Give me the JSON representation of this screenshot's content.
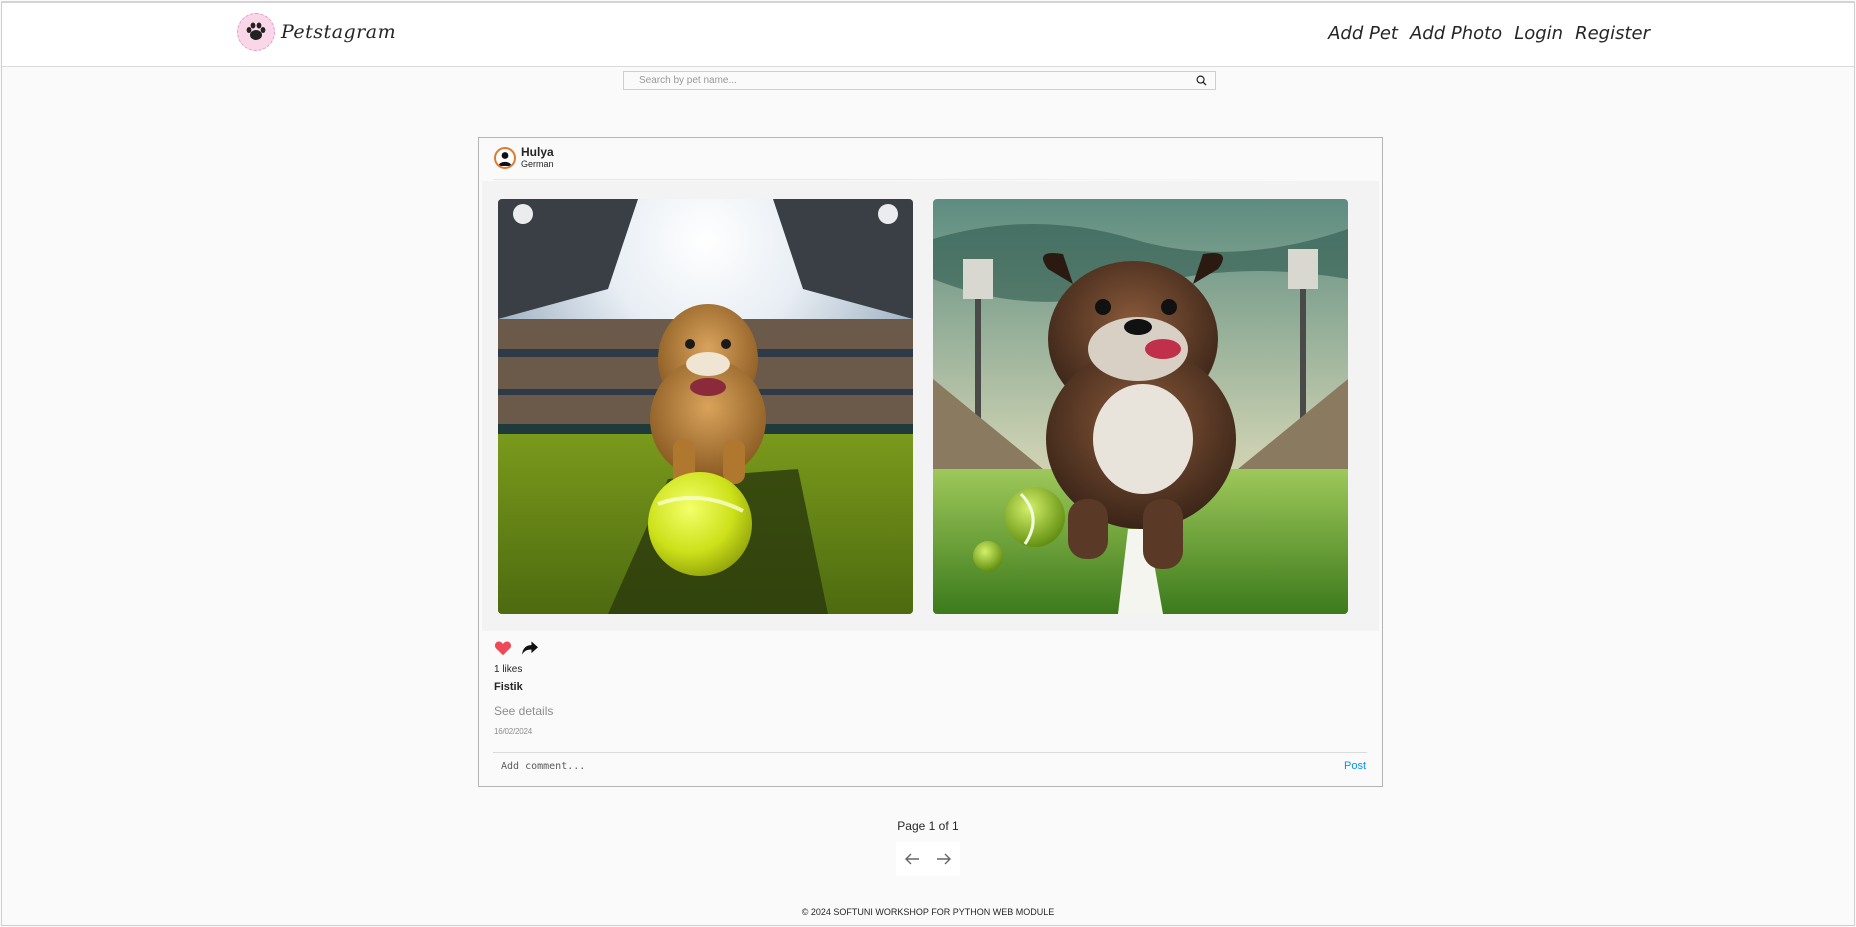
{
  "app": {
    "name": "Petstagram",
    "brand_color": "#262626",
    "accent_pink": "#f9d6e8"
  },
  "nav": {
    "items": [
      "Add Pet",
      "Add Photo",
      "Login",
      "Register"
    ]
  },
  "search": {
    "placeholder": "Search by pet name...",
    "icon": "search-icon"
  },
  "post": {
    "owner": {
      "name": "Hulya",
      "subtitle": "German",
      "avatar_icon": "user-silhouette-icon"
    },
    "photos": [
      {
        "description_icon": "bulldog-stadium-photo-1"
      },
      {
        "description_icon": "bulldog-stadium-photo-2"
      }
    ],
    "like_icon": "heart-icon",
    "share_icon": "share-arrow-icon",
    "like_color": "#ed4956",
    "likes_text": "1 likes",
    "pet_name": "Fistik",
    "details_link": "See details",
    "date": "16/02/2024",
    "comment_placeholder": "Add comment...",
    "post_button": "Post",
    "post_button_color": "#0095f6"
  },
  "pagination": {
    "text": "Page 1 of 1",
    "prev_icon": "arrow-left-icon",
    "next_icon": "arrow-right-icon"
  },
  "footer": {
    "text": "© 2024 SOFTUNI WORKSHOP FOR PYTHON WEB MODULE"
  }
}
